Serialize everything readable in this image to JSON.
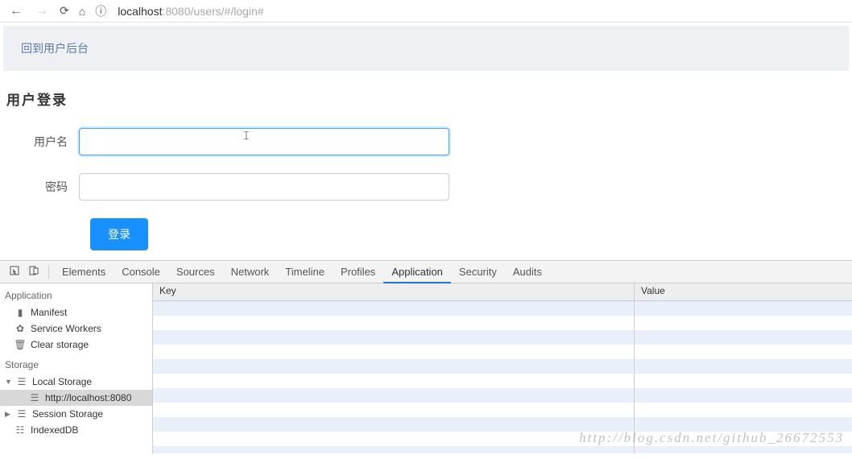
{
  "browser": {
    "url_prefix": "localhost",
    "url_port": ":8080",
    "url_path": "/users/#/login#"
  },
  "banner": {
    "link": "回到用户后台"
  },
  "page": {
    "title": "用户登录",
    "username_label": "用户名",
    "password_label": "密码",
    "username_value": "",
    "password_value": "",
    "login_button": "登录"
  },
  "devtools": {
    "tabs": [
      "Elements",
      "Console",
      "Sources",
      "Network",
      "Timeline",
      "Profiles",
      "Application",
      "Security",
      "Audits"
    ],
    "active_tab": "Application",
    "sidebar": {
      "section_app": "Application",
      "app_items": [
        "Manifest",
        "Service Workers",
        "Clear storage"
      ],
      "section_storage": "Storage",
      "local_storage": "Local Storage",
      "local_storage_item": "http://localhost:8080",
      "session_storage": "Session Storage",
      "indexeddb": "IndexedDB"
    },
    "kv": {
      "key_header": "Key",
      "value_header": "Value",
      "rows": []
    }
  },
  "watermark": "http://blog.csdn.net/github_26672553"
}
